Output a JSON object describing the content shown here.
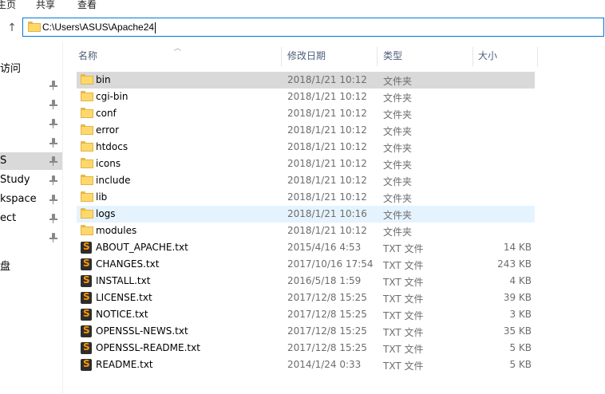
{
  "ribbon": {
    "tabs": [
      "主页",
      "共享",
      "查看"
    ]
  },
  "address": {
    "path": "C:\\Users\\ASUS\\Apache24"
  },
  "nav": {
    "items": [
      {
        "label": "访问",
        "pinned": false
      },
      {
        "label": "",
        "pinned": true
      },
      {
        "label": "",
        "pinned": true
      },
      {
        "label": "",
        "pinned": true
      },
      {
        "label": "",
        "pinned": true
      },
      {
        "label": "S",
        "pinned": true,
        "selected": true
      },
      {
        "label": "Study",
        "pinned": true
      },
      {
        "label": "kspace",
        "pinned": true
      },
      {
        "label": "ect",
        "pinned": true
      },
      {
        "label": "",
        "pinned": true
      },
      {
        "label": "盘",
        "pinned": false
      }
    ]
  },
  "columns": {
    "name": "名称",
    "date": "修改日期",
    "type": "类型",
    "size": "大小"
  },
  "files": [
    {
      "name": "bin",
      "date": "2018/1/21 10:12",
      "type": "文件夹",
      "size": "",
      "kind": "folder",
      "state": "selected"
    },
    {
      "name": "cgi-bin",
      "date": "2018/1/21 10:12",
      "type": "文件夹",
      "size": "",
      "kind": "folder"
    },
    {
      "name": "conf",
      "date": "2018/1/21 10:12",
      "type": "文件夹",
      "size": "",
      "kind": "folder"
    },
    {
      "name": "error",
      "date": "2018/1/21 10:12",
      "type": "文件夹",
      "size": "",
      "kind": "folder"
    },
    {
      "name": "htdocs",
      "date": "2018/1/21 10:12",
      "type": "文件夹",
      "size": "",
      "kind": "folder"
    },
    {
      "name": "icons",
      "date": "2018/1/21 10:12",
      "type": "文件夹",
      "size": "",
      "kind": "folder"
    },
    {
      "name": "include",
      "date": "2018/1/21 10:12",
      "type": "文件夹",
      "size": "",
      "kind": "folder"
    },
    {
      "name": "lib",
      "date": "2018/1/21 10:12",
      "type": "文件夹",
      "size": "",
      "kind": "folder"
    },
    {
      "name": "logs",
      "date": "2018/1/21 10:16",
      "type": "文件夹",
      "size": "",
      "kind": "folder",
      "state": "hover"
    },
    {
      "name": "modules",
      "date": "2018/1/21 10:12",
      "type": "文件夹",
      "size": "",
      "kind": "folder"
    },
    {
      "name": "ABOUT_APACHE.txt",
      "date": "2015/4/16 4:53",
      "type": "TXT 文件",
      "size": "14 KB",
      "kind": "txt"
    },
    {
      "name": "CHANGES.txt",
      "date": "2017/10/16 17:54",
      "type": "TXT 文件",
      "size": "243 KB",
      "kind": "txt"
    },
    {
      "name": "INSTALL.txt",
      "date": "2016/5/18 1:59",
      "type": "TXT 文件",
      "size": "4 KB",
      "kind": "txt"
    },
    {
      "name": "LICENSE.txt",
      "date": "2017/12/8 15:25",
      "type": "TXT 文件",
      "size": "39 KB",
      "kind": "txt"
    },
    {
      "name": "NOTICE.txt",
      "date": "2017/12/8 15:25",
      "type": "TXT 文件",
      "size": "3 KB",
      "kind": "txt"
    },
    {
      "name": "OPENSSL-NEWS.txt",
      "date": "2017/12/8 15:25",
      "type": "TXT 文件",
      "size": "35 KB",
      "kind": "txt"
    },
    {
      "name": "OPENSSL-README.txt",
      "date": "2017/12/8 15:25",
      "type": "TXT 文件",
      "size": "5 KB",
      "kind": "txt"
    },
    {
      "name": "README.txt",
      "date": "2014/1/24 0:33",
      "type": "TXT 文件",
      "size": "5 KB",
      "kind": "txt"
    }
  ]
}
